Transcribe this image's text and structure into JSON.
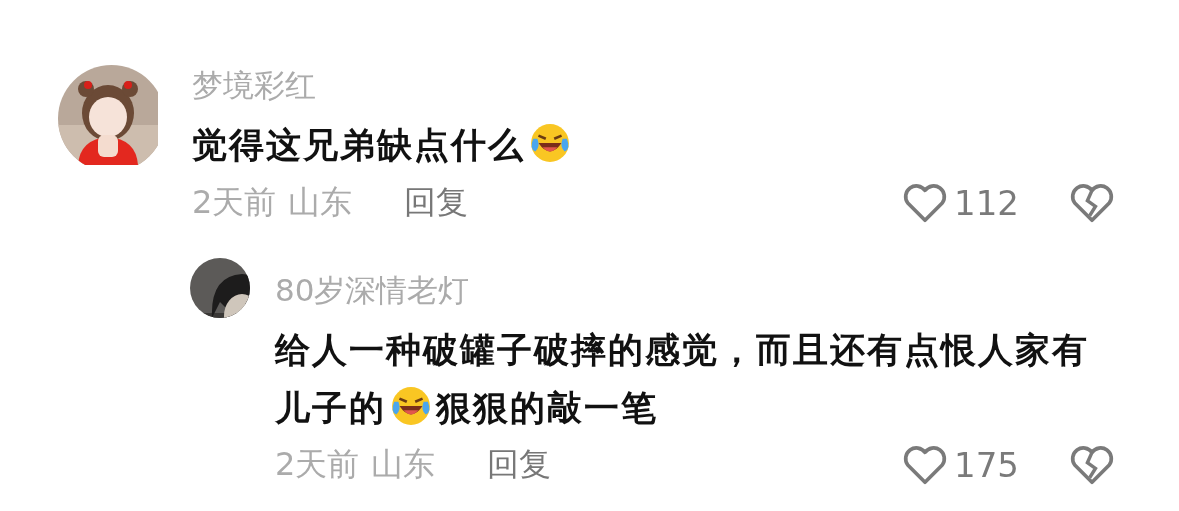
{
  "comments": [
    {
      "author": "梦境彩红",
      "avatar": {
        "kind": "picture"
      },
      "content": [
        {
          "kind": "text",
          "text": "觉得这兄弟缺点什么"
        },
        {
          "kind": "emoji"
        }
      ],
      "time": "2天前",
      "location": "山东",
      "reply_label": "回复",
      "like_count": "112",
      "replies": [
        {
          "author": "80岁深情老灯",
          "avatar": {
            "kind": "picture"
          },
          "content": [
            {
              "kind": "text",
              "text": "给人一种破罐子破摔的感觉，而且还有点恨人家有儿子的"
            },
            {
              "kind": "emoji"
            },
            {
              "kind": "text",
              "text": "狠狠的敲一笔"
            }
          ],
          "time": "2天前",
          "location": "山东",
          "reply_label": "回复",
          "like_count": "175"
        }
      ]
    }
  ]
}
